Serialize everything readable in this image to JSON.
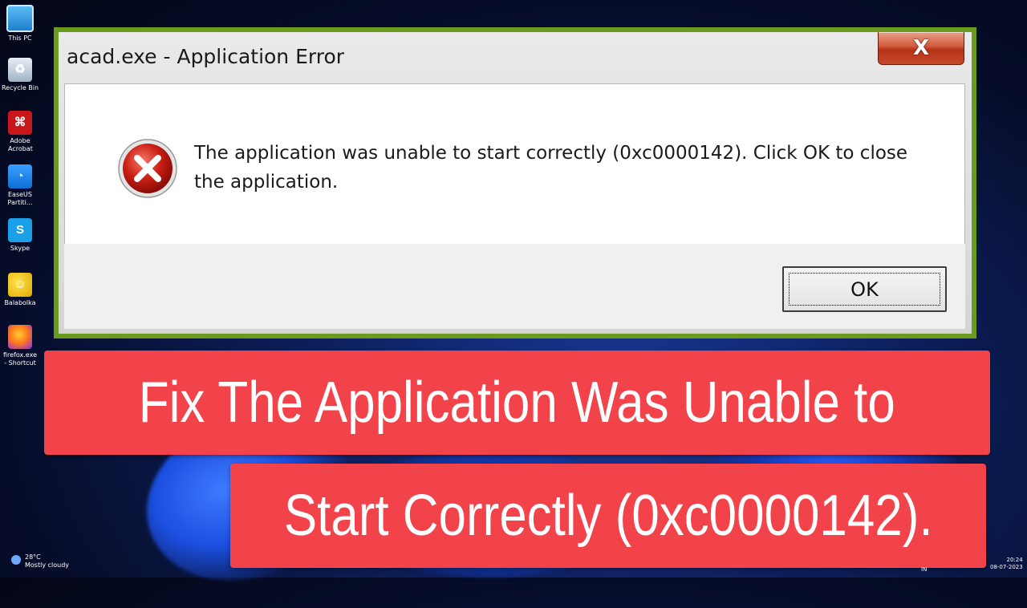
{
  "desktop": {
    "icons": [
      {
        "label": "This PC",
        "icon": "this-pc-icon"
      },
      {
        "label": "Recycle Bin",
        "icon": "recycle-bin-icon"
      },
      {
        "label": "Adobe Acrobat",
        "icon": "adobe-acrobat-icon"
      },
      {
        "label": "EaseUS Partiti...",
        "icon": "easeus-icon"
      },
      {
        "label": "Skype",
        "icon": "skype-icon"
      },
      {
        "label": "Balabolka",
        "icon": "balabolka-icon"
      },
      {
        "label": "firefox.exe - Shortcut",
        "icon": "firefox-icon"
      }
    ]
  },
  "dialog": {
    "title": "acad.exe - Application Error",
    "close_label": "X",
    "message": "The application was unable to start correctly (0xc0000142). Click OK to close the application.",
    "ok_label": "OK",
    "frame_color": "#6a9a1e"
  },
  "banner": {
    "line1": "Fix The Application Was Unable to",
    "line2": "Start Correctly (0xc0000142).",
    "color": "#f2434a"
  },
  "taskbar": {
    "weather_temp": "28°C",
    "weather_desc": "Mostly cloudy",
    "time": "20:24",
    "date": "08-07-2023",
    "language": "IN"
  }
}
